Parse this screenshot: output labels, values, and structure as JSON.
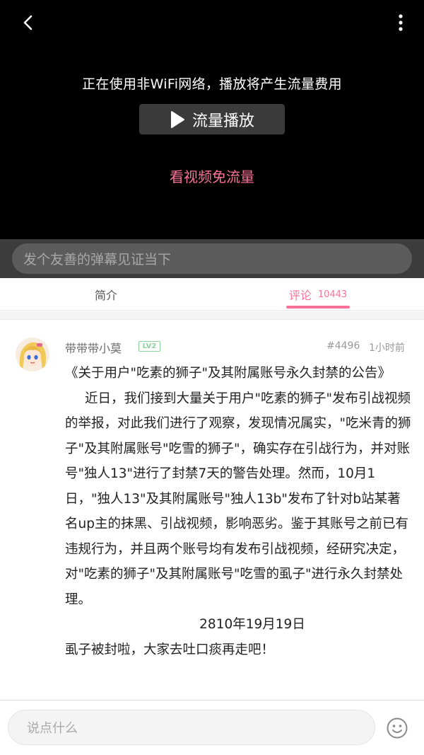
{
  "player": {
    "notice": "正在使用非WiFi网络，播放将产生流量费用",
    "play_label": "流量播放",
    "free_link": "看视频免流量",
    "back_icon": "chevron-left-icon",
    "more_icon": "more-vertical-icon"
  },
  "danmaku": {
    "placeholder": "发个友善的弹幕见证当下"
  },
  "tabs": [
    {
      "label": "简介",
      "count": ""
    },
    {
      "label": "评论",
      "count": "10443"
    }
  ],
  "comment": {
    "username": "带带带小莫",
    "level": "LV2",
    "floor": "#4496",
    "time": "1小时前",
    "lines": {
      "title": "《关于用户\"吃素的狮子\"及其附属账号永久封禁的公告》",
      "para": "近日，我们接到大量关于用户\"吃素的狮子\"发布引战视频的举报，对此我们进行了观察，发现情况属实，\"吃米青的狮子\"及其附属账号\"吃雪的狮子\"，确实存在引战行为，并对账号\"独人13\"进行了封禁7天的警告处理。然而，10月1日，\"独人13\"及其附属账号\"独人13b\"发布了针对b站某著名up主的抹黑、引战视频，影响恶劣。鉴于其账号之前已有违规行为，并且两个账号均有发布引战视频，经研究决定，对\"吃素的狮子\"及其附属账号\"吃雪的虱子\"进行永久封禁处理。",
      "date": "2810年19月19日",
      "last": "虱子被封啦，大家去吐口痰再走吧！"
    }
  },
  "reply": {
    "placeholder": "说点什么",
    "emoji_icon": "smiley-icon"
  },
  "colors": {
    "accent": "#fb7299",
    "player_bg": "#000000",
    "level_badge": "#8bd29b"
  }
}
